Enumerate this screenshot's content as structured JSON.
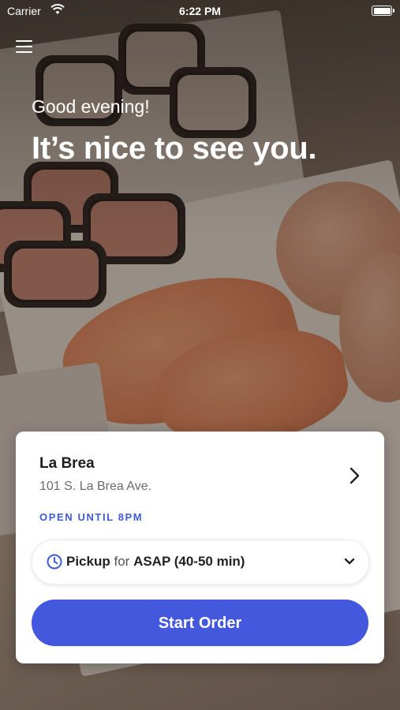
{
  "status_bar": {
    "carrier": "Carrier",
    "time": "6:22 PM"
  },
  "hero": {
    "greeting": "Good evening!",
    "headline": "It’s nice to see you."
  },
  "location_card": {
    "name": "La Brea",
    "address": "101 S. La Brea Ave.",
    "hours": "OPEN UNTIL 8PM",
    "order_mode": {
      "type": "Pickup",
      "connector": "for",
      "time": "ASAP (40-50 min)"
    },
    "start_button": "Start Order"
  },
  "colors": {
    "accent": "#4358dd",
    "hours_text": "#3e5bd9"
  },
  "icons": [
    "menu-icon",
    "wifi-icon",
    "battery-icon",
    "chevron-right-icon",
    "clock-icon",
    "chevron-down-icon"
  ]
}
